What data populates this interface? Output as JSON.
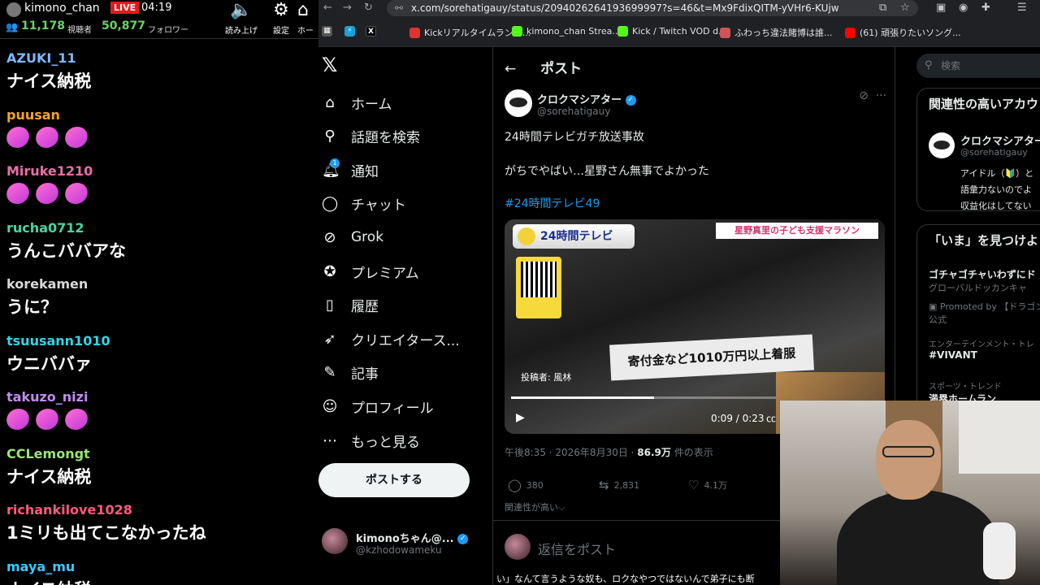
{
  "stream": {
    "channel": "kimono_chan",
    "live_badge": "LIVE",
    "elapsed": "04:19",
    "viewers": "11,178",
    "viewers_label": "視聴者",
    "followers": "50,877",
    "followers_label": "フォロワー",
    "tools": [
      {
        "label": "読み上げ",
        "icon": "speaker-icon"
      },
      {
        "label": "設定",
        "icon": "gear-icon"
      },
      {
        "label": "ホー",
        "icon": "home-icon"
      }
    ]
  },
  "chat": [
    {
      "user": "AZUKI_11",
      "color": "#7fb7ff",
      "text": "ナイス納税"
    },
    {
      "user": "puusan",
      "color": "#f5a623",
      "text": "",
      "emotes": 3
    },
    {
      "user": "Miruke1210",
      "color": "#e870a8",
      "text": "",
      "emotes": 3
    },
    {
      "user": "rucha0712",
      "color": "#45d6a6",
      "text": "うんこババアな"
    },
    {
      "user": "korekamen",
      "color": "#d9d9d9",
      "text": "うに？"
    },
    {
      "user": "tsuusann1010",
      "color": "#35d4e8",
      "text": "ウニババァ"
    },
    {
      "user": "takuzo_nizi",
      "color": "#c08bf0",
      "text": "",
      "emotes": 3
    },
    {
      "user": "CCLemongt",
      "color": "#9be37a",
      "text": "ナイス納税"
    },
    {
      "user": "richankilove1028",
      "color": "#ff5a7a",
      "text": "1ミリも出てこなかったね"
    },
    {
      "user": "maya_mu",
      "color": "#3ec7ff",
      "text": "ナイス納税"
    }
  ],
  "browser": {
    "url": "x.com/sorehatigauy/status/2094026264193699997?s=46&t=Mx9FdixQITM-yVHr6-KUjw",
    "bookmarks": [
      {
        "label": "Kickリアルタイムランキ...",
        "color": "#d33"
      },
      {
        "label": "kimono_chan Strea...",
        "color": "#53fc18"
      },
      {
        "label": "Kick / Twitch VOD d...",
        "color": "#53fc18"
      },
      {
        "label": "ふわっち違法賭博は誰...",
        "color": "#c55"
      },
      {
        "label": "(61) 頑張りたいソング...",
        "color": "#f00"
      }
    ]
  },
  "x": {
    "nav": [
      {
        "label": "ホーム",
        "icon": "home-icon"
      },
      {
        "label": "話題を検索",
        "icon": "search-icon"
      },
      {
        "label": "通知",
        "icon": "bell-icon",
        "badge": "1"
      },
      {
        "label": "チャット",
        "icon": "chat-icon"
      },
      {
        "label": "Grok",
        "icon": "grok-icon"
      },
      {
        "label": "プレミアム",
        "icon": "premium-icon"
      },
      {
        "label": "履歴",
        "icon": "bookmark-icon"
      },
      {
        "label": "クリエイタース...",
        "icon": "rocket-icon"
      },
      {
        "label": "記事",
        "icon": "article-icon"
      },
      {
        "label": "プロフィール",
        "icon": "profile-icon"
      },
      {
        "label": "もっと見る",
        "icon": "more-icon"
      }
    ],
    "post_button": "ポストする",
    "account": {
      "name": "kimonoちゃん@...",
      "handle": "@kzhodowameku"
    },
    "header": "ポスト",
    "post": {
      "author_name": "クロクマシアター",
      "author_handle": "@sorehatigauy",
      "line1": "24時間テレビガチ放送事故",
      "line2": "がちでやばい…星野さん無事でよかった",
      "hashtag": "#24時間テレビ49",
      "video": {
        "top_tag": "24時間テレビ",
        "right_tag": "星野真里の子ども支援マラソン",
        "caption": "寄付金など1010万円以上着服",
        "poster": "投稿者: 風林",
        "time": "0:09 / 0:23",
        "progress": 0.39
      },
      "timestamp": "午後8:35 · 2026年8月30日 · ",
      "views": "86.9万",
      "views_label": " 件の表示",
      "replies": "380",
      "reposts": "2,831",
      "likes": "4.1万",
      "relevance": "関連性が高い⌵",
      "reply_placeholder": "返信をポスト",
      "subtitle": "い」なんて言うような奴も、ロクなやつではないんで弟子にも断"
    },
    "right": {
      "search_placeholder": "検索",
      "related_title": "関連性の高いアカウ",
      "related_name": "クロクマシアター",
      "related_handle": "@sorehatigauy",
      "related_bio": [
        "アイドル（🔰）と",
        "語彙力ないのでよ",
        "収益化はしてない"
      ],
      "trend_title": "「いま」を見つけよ",
      "trends": [
        {
          "cat": "",
          "title": "ゴチャゴチャいわずにド",
          "sub": "グローバルドッカンキャ"
        },
        {
          "cat": "",
          "title": "",
          "sub": "Promoted by 【ドラゴンボ"
        },
        {
          "cat": "",
          "title": "",
          "sub": "公式"
        },
        {
          "cat": "エンターテインメント・トレ",
          "title": "#VIVANT",
          "sub": ""
        },
        {
          "cat": "スポーツ・トレンド",
          "title": "満塁ホームラン",
          "sub": ""
        }
      ]
    }
  }
}
